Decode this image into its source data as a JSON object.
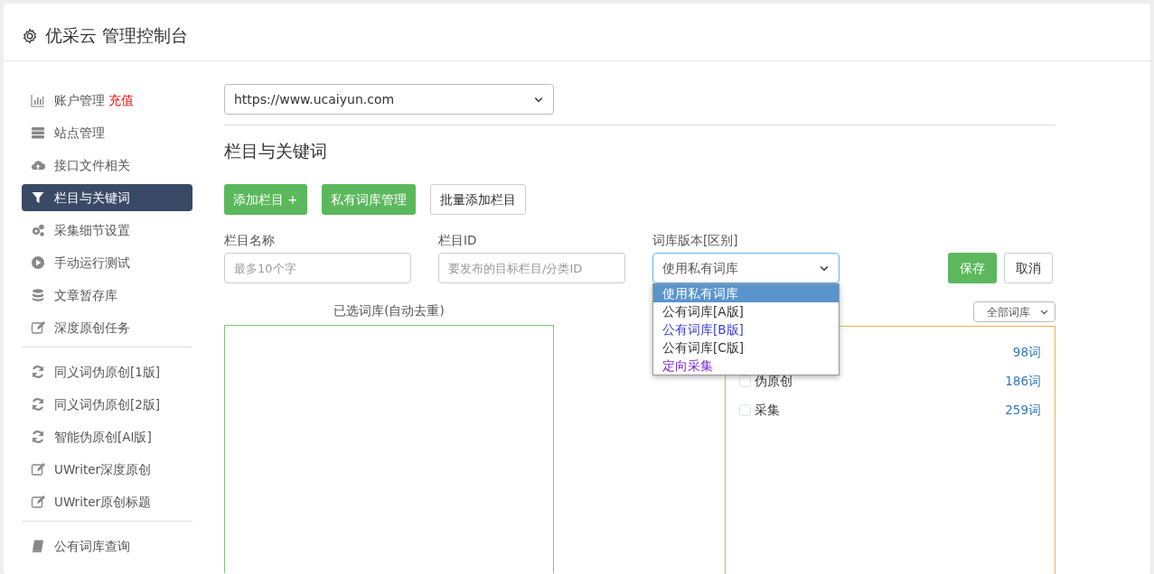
{
  "window": {
    "title": "优采云 管理控制台"
  },
  "sidebar": {
    "groups": [
      {
        "items": [
          {
            "label": "账户管理",
            "badge": "充值",
            "selected": false
          },
          {
            "label": "站点管理",
            "selected": false
          },
          {
            "label": "接口文件相关",
            "selected": false
          },
          {
            "label": "栏目与关键词",
            "selected": true
          },
          {
            "label": "采集细节设置",
            "selected": false
          },
          {
            "label": "手动运行测试",
            "selected": false
          },
          {
            "label": "文章暂存库",
            "selected": false
          },
          {
            "label": "深度原创任务",
            "selected": false
          }
        ]
      },
      {
        "items": [
          {
            "label": "同义词伪原创[1版]",
            "selected": false
          },
          {
            "label": "同义词伪原创[2版]",
            "selected": false
          },
          {
            "label": "智能伪原创[AI版]",
            "selected": false
          },
          {
            "label": "UWriter深度原创",
            "selected": false
          },
          {
            "label": "UWriter原创标题",
            "selected": false
          }
        ]
      },
      {
        "items": [
          {
            "label": "公有词库查询",
            "selected": false
          }
        ]
      }
    ]
  },
  "site_select": {
    "value": "https://www.ucaiyun.com"
  },
  "section_title": "栏目与关键词",
  "buttons": [
    {
      "label": "添加栏目 +",
      "kind": "green"
    },
    {
      "label": "私有词库管理",
      "kind": "green"
    },
    {
      "label": "批量添加栏目",
      "kind": "plain"
    }
  ],
  "form": {
    "name_field": {
      "label": "栏目名称",
      "placeholder": "最多10个字"
    },
    "id_field": {
      "label": "栏目ID",
      "placeholder": "要发布的目标栏目/分类ID"
    },
    "version_select": {
      "label": "词库版本[区别]",
      "value": "使用私有词库",
      "expanded": true,
      "options": [
        {
          "label": "使用私有词库",
          "selected": true
        },
        {
          "label": "公有词库[A版]",
          "selected": false,
          "color": "#333333"
        },
        {
          "label": "公有词库[B版]",
          "selected": false,
          "color": "#3b3bd6"
        },
        {
          "label": "公有词库[C版]",
          "selected": false,
          "color": "#333333"
        },
        {
          "label": "定向采集",
          "selected": false,
          "color": "#7a22d8"
        }
      ]
    },
    "save_button": "保存",
    "cancel_button": "取消"
  },
  "selected_panel": {
    "title": "已选词库(自动去重)"
  },
  "library_panel": {
    "filter": "全部词库",
    "items": [
      {
        "count": "98词"
      },
      {
        "label": "伪原创",
        "count": "186词",
        "checked": false
      },
      {
        "label": "采集",
        "count": "259词",
        "checked": false
      }
    ]
  }
}
